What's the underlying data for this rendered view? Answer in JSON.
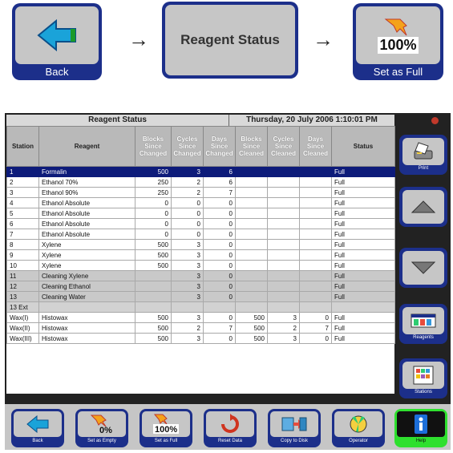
{
  "top_strip": {
    "back_label": "Back",
    "reagent_status_label": "Reagent Status",
    "set_full_label": "Set as Full",
    "percent_text": "100%",
    "arrow": "→"
  },
  "screen": {
    "title": "Reagent Status",
    "datetime": "Thursday, 20 July 2006 1:10:01 PM",
    "columns": [
      "Station",
      "Reagent",
      "Blocks Since Changed",
      "Cycles Since Changed",
      "Days Since Changed",
      "Blocks Since Cleaned",
      "Cycles Since Cleaned",
      "Days Since Cleaned",
      "Status"
    ],
    "rows": [
      [
        "1",
        "Formalin",
        "500",
        "3",
        "6",
        "",
        "",
        "",
        "Full"
      ],
      [
        "2",
        "Ethanol 70%",
        "250",
        "2",
        "6",
        "",
        "",
        "",
        "Full"
      ],
      [
        "3",
        "Ethanol 90%",
        "250",
        "2",
        "7",
        "",
        "",
        "",
        "Full"
      ],
      [
        "4",
        "Ethanol Absolute",
        "0",
        "0",
        "0",
        "",
        "",
        "",
        "Full"
      ],
      [
        "5",
        "Ethanol Absolute",
        "0",
        "0",
        "0",
        "",
        "",
        "",
        "Full"
      ],
      [
        "6",
        "Ethanol Absolute",
        "0",
        "0",
        "0",
        "",
        "",
        "",
        "Full"
      ],
      [
        "7",
        "Ethanol Absolute",
        "0",
        "0",
        "0",
        "",
        "",
        "",
        "Full"
      ],
      [
        "8",
        "Xylene",
        "500",
        "3",
        "0",
        "",
        "",
        "",
        "Full"
      ],
      [
        "9",
        "Xylene",
        "500",
        "3",
        "0",
        "",
        "",
        "",
        "Full"
      ],
      [
        "10",
        "Xylene",
        "500",
        "3",
        "0",
        "",
        "",
        "",
        "Full"
      ],
      [
        "11",
        "Cleaning Xylene",
        "",
        "3",
        "0",
        "",
        "",
        "",
        "Full"
      ],
      [
        "12",
        "Cleaning Ethanol",
        "",
        "3",
        "0",
        "",
        "",
        "",
        "Full"
      ],
      [
        "13",
        "Cleaning Water",
        "",
        "3",
        "0",
        "",
        "",
        "",
        "Full"
      ],
      [
        "13 Ext",
        "",
        "",
        "",
        "",
        "",
        "",
        "",
        ""
      ],
      [
        "Wax(I)",
        "Histowax",
        "500",
        "3",
        "0",
        "500",
        "3",
        "0",
        "Full"
      ],
      [
        "Wax(II)",
        "Histowax",
        "500",
        "2",
        "7",
        "500",
        "2",
        "7",
        "Full"
      ],
      [
        "Wax(III)",
        "Histowax",
        "500",
        "3",
        "0",
        "500",
        "3",
        "0",
        "Full"
      ]
    ]
  },
  "side_buttons": {
    "print": "Print",
    "reagents": "Reagents",
    "stations": "Stations"
  },
  "bottom_bar": {
    "back": "Back",
    "set_as_empty": "Set as Empty",
    "set_as_full": "Set as Full",
    "reset_data": "Reset Data",
    "copy_to_disk": "Copy to Disk",
    "operator": "Operator",
    "help": "Help",
    "empty_pct": "0%",
    "full_pct": "100%"
  },
  "colors": {
    "button_blue": "#1c2f8a",
    "selected_row": "#0d1b7a",
    "help_green": "#2ee02e"
  }
}
